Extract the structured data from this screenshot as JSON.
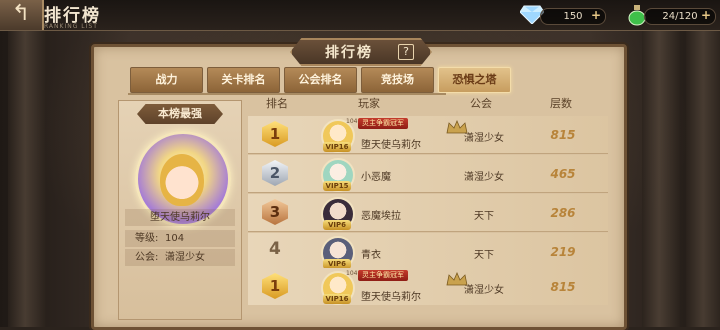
{
  "header": {
    "title": "排行榜",
    "subtitle": "RANKING LIST",
    "back_icon": "back-arrow-icon"
  },
  "resources": {
    "gems": {
      "icon": "diamond-icon",
      "value": "150"
    },
    "stamina": {
      "icon": "stamina-potion-icon",
      "value": "24/120"
    }
  },
  "panel": {
    "title": "排行榜",
    "help_icon": "question-icon"
  },
  "tabs": [
    {
      "label": "战力",
      "active": false
    },
    {
      "label": "关卡排名",
      "active": false
    },
    {
      "label": "公会排名",
      "active": false
    },
    {
      "label": "竞技场",
      "active": false
    },
    {
      "label": "恐惧之塔",
      "active": true
    }
  ],
  "strongest": {
    "title": "本榜最强",
    "name": "堕天使乌莉尔",
    "level_label": "等级:",
    "level_value": "104",
    "guild_label": "公会:",
    "guild_value": "潇湿少女"
  },
  "table": {
    "columns": [
      "排名",
      "玩家",
      "公会",
      "层数"
    ],
    "rows": [
      {
        "rank": "1",
        "badge": "gold",
        "level": "104",
        "vip": "VIP16",
        "name": "堕天使乌莉尔",
        "champion_tag": "灵主争霸冠军",
        "guild": "潇湿少女",
        "crown": "guild-crown-icon",
        "floor": "815",
        "avatar_color": "#f0c85a"
      },
      {
        "rank": "2",
        "badge": "silver",
        "level": "",
        "vip": "VIP15",
        "name": "小恶魔",
        "champion_tag": "",
        "guild": "潇湿少女",
        "crown": "",
        "floor": "465",
        "avatar_color": "#9fd6c0"
      },
      {
        "rank": "3",
        "badge": "bronze",
        "level": "",
        "vip": "VIP6",
        "name": "恶魔埃拉",
        "champion_tag": "",
        "guild": "天下",
        "crown": "",
        "floor": "286",
        "avatar_color": "#3a2c3a"
      },
      {
        "rank": "4",
        "badge": "none",
        "level": "",
        "vip": "VIP6",
        "name": "青衣",
        "champion_tag": "",
        "guild": "天下",
        "crown": "",
        "floor": "219",
        "avatar_color": "#5a5f7a"
      },
      {
        "rank": "1",
        "badge": "gold",
        "level": "104",
        "vip": "VIP16",
        "name": "堕天使乌莉尔",
        "champion_tag": "灵主争霸冠军",
        "guild": "潇湿少女",
        "crown": "guild-crown-icon",
        "floor": "815",
        "avatar_color": "#f0c85a"
      }
    ]
  }
}
